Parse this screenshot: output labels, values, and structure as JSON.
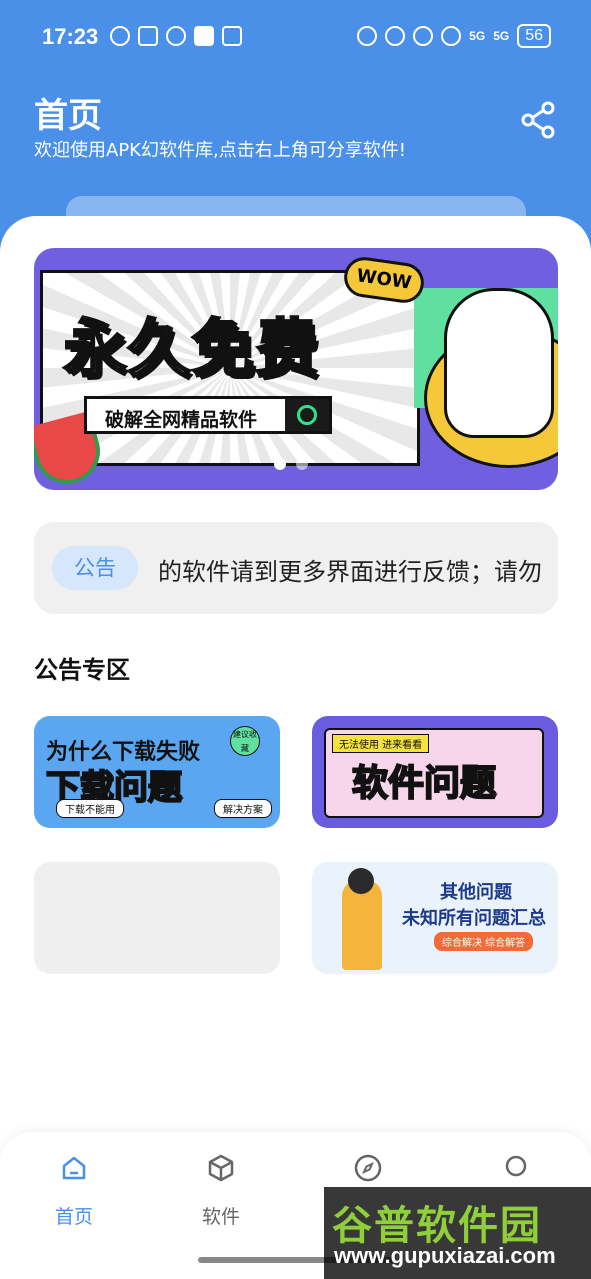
{
  "status_bar": {
    "time": "17:23",
    "signal_1": "5G",
    "signal_2": "5G",
    "battery": "56"
  },
  "header": {
    "title": "首页",
    "subtitle": "欢迎使用APK幻软件库,点击右上角可分享软件!",
    "share_icon": "share-icon",
    "bg_color": "#4a90e8"
  },
  "banner": {
    "headline": "永久免费",
    "search_text": "破解全网精品软件",
    "sticker": "WOW",
    "slides": 2,
    "active_slide": 1
  },
  "notice": {
    "badge": "公告",
    "text": "的软件请到更多界面进行反馈；请勿"
  },
  "section": {
    "title": "公告专区"
  },
  "tiles": {
    "download": {
      "line1": "为什么下载失败",
      "line2": "下载问题",
      "tag": "建议收藏",
      "chip_left": "下载不能用",
      "chip_right": "解决方案"
    },
    "software": {
      "top": "无法使用 进来看看",
      "main": "软件问题"
    },
    "other": {
      "line1": "其他问题",
      "line2": "未知所有问题汇总",
      "chip": "综合解决 综合解答"
    }
  },
  "bottom_nav": {
    "items": [
      {
        "label": "首页",
        "icon": "home-icon",
        "active": true
      },
      {
        "label": "软件",
        "icon": "cube-icon",
        "active": false
      },
      {
        "label": "",
        "icon": "compass-icon",
        "active": false
      },
      {
        "label": "",
        "icon": "user-icon",
        "active": false
      }
    ],
    "active_color": "#4a90e8"
  },
  "watermark": {
    "logo": "谷普软件园",
    "url": "www.gupuxiazai.com"
  }
}
